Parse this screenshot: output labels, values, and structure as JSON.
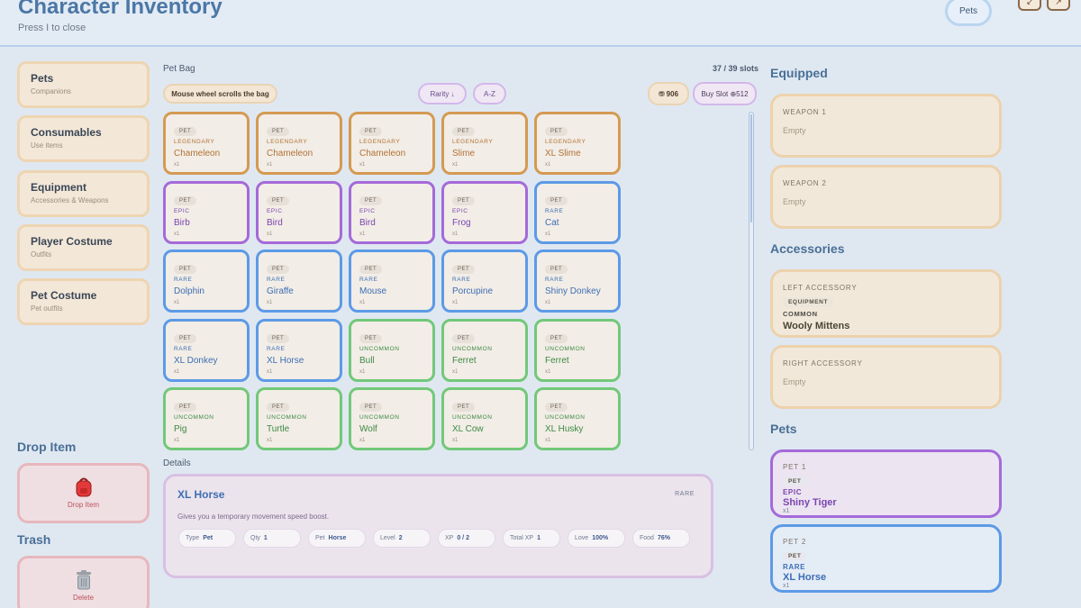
{
  "header": {
    "title": "Character Inventory",
    "subtitle": "Press I to close",
    "tab_label": "Pets"
  },
  "categories": [
    {
      "name": "Pets",
      "sub": "Companions"
    },
    {
      "name": "Consumables",
      "sub": "Use items"
    },
    {
      "name": "Equipment",
      "sub": "Accessories & Weapons"
    },
    {
      "name": "Player Costume",
      "sub": "Outfits"
    },
    {
      "name": "Pet Costume",
      "sub": "Pet outfits"
    }
  ],
  "drop": {
    "title": "Drop Item",
    "label": "Drop Item"
  },
  "trash": {
    "title": "Trash",
    "label": "Delete"
  },
  "bag": {
    "label": "Pet Bag",
    "slots": "37 / 39 slots",
    "scroll_hint": "Mouse wheel scrolls the bag",
    "sort_rarity": "Rarity ↓",
    "sort_az": "A-Z",
    "coins": "906",
    "buy_slot": "Buy Slot ⊕512",
    "tag": "PET",
    "items": [
      {
        "rarity": "LEGENDARY",
        "name": "Chameleon",
        "qty": "x1"
      },
      {
        "rarity": "LEGENDARY",
        "name": "Chameleon",
        "qty": "x1"
      },
      {
        "rarity": "LEGENDARY",
        "name": "Chameleon",
        "qty": "x1"
      },
      {
        "rarity": "LEGENDARY",
        "name": "Slime",
        "qty": "x1"
      },
      {
        "rarity": "LEGENDARY",
        "name": "XL Slime",
        "qty": "x1"
      },
      {
        "rarity": "EPIC",
        "name": "Birb",
        "qty": "x1"
      },
      {
        "rarity": "EPIC",
        "name": "Bird",
        "qty": "x1"
      },
      {
        "rarity": "EPIC",
        "name": "Bird",
        "qty": "x1"
      },
      {
        "rarity": "EPIC",
        "name": "Frog",
        "qty": "x1"
      },
      {
        "rarity": "RARE",
        "name": "Cat",
        "qty": "x1"
      },
      {
        "rarity": "RARE",
        "name": "Dolphin",
        "qty": "x1"
      },
      {
        "rarity": "RARE",
        "name": "Giraffe",
        "qty": "x1"
      },
      {
        "rarity": "RARE",
        "name": "Mouse",
        "qty": "x1"
      },
      {
        "rarity": "RARE",
        "name": "Porcupine",
        "qty": "x1"
      },
      {
        "rarity": "RARE",
        "name": "Shiny Donkey",
        "qty": "x1"
      },
      {
        "rarity": "RARE",
        "name": "XL Donkey",
        "qty": "x1"
      },
      {
        "rarity": "RARE",
        "name": "XL Horse",
        "qty": "x1"
      },
      {
        "rarity": "UNCOMMON",
        "name": "Bull",
        "qty": "x1"
      },
      {
        "rarity": "UNCOMMON",
        "name": "Ferret",
        "qty": "x1"
      },
      {
        "rarity": "UNCOMMON",
        "name": "Ferret",
        "qty": "x1"
      },
      {
        "rarity": "UNCOMMON",
        "name": "Pig",
        "qty": "x1"
      },
      {
        "rarity": "UNCOMMON",
        "name": "Turtle",
        "qty": "x1"
      },
      {
        "rarity": "UNCOMMON",
        "name": "Wolf",
        "qty": "x1"
      },
      {
        "rarity": "UNCOMMON",
        "name": "XL Cow",
        "qty": "x1"
      },
      {
        "rarity": "UNCOMMON",
        "name": "XL Husky",
        "qty": "x1"
      }
    ]
  },
  "details": {
    "label": "Details",
    "name": "XL Horse",
    "rarity": "RARE",
    "description": "Gives you a temporary movement speed boost.",
    "stats": [
      {
        "k": "Type",
        "v": "Pet"
      },
      {
        "k": "Qty",
        "v": "1"
      },
      {
        "k": "Pet",
        "v": "Horse"
      },
      {
        "k": "Level",
        "v": "2"
      },
      {
        "k": "XP",
        "v": "0 / 2"
      },
      {
        "k": "Total XP",
        "v": "1"
      },
      {
        "k": "Love",
        "v": "100%"
      },
      {
        "k": "Food",
        "v": "76%"
      }
    ]
  },
  "equipped": {
    "title": "Equipped",
    "weapon1": {
      "label": "WEAPON 1",
      "value": "Empty"
    },
    "weapon2": {
      "label": "WEAPON 2",
      "value": "Empty"
    },
    "accessories_title": "Accessories",
    "left_acc": {
      "label": "LEFT ACCESSORY",
      "tag": "EQUIPMENT",
      "rarity": "COMMON",
      "item": "Wooly Mittens"
    },
    "right_acc": {
      "label": "RIGHT ACCESSORY",
      "value": "Empty"
    },
    "pets_title": "Pets",
    "pet1": {
      "label": "PET 1",
      "tag": "PET",
      "rarity": "EPIC",
      "name": "Shiny Tiger",
      "qty": "x1"
    },
    "pet2": {
      "label": "PET 2",
      "tag": "PET",
      "rarity": "RARE",
      "name": "XL Horse",
      "qty": "x1"
    }
  },
  "colors": {
    "legendary": "#d49a52",
    "epic": "#a46ad9",
    "rare": "#5d9ae6",
    "uncommon": "#72c87a",
    "title": "#4b77a6"
  },
  "icons": [
    "backpack-icon",
    "trash-can-icon",
    "coin-icon"
  ]
}
